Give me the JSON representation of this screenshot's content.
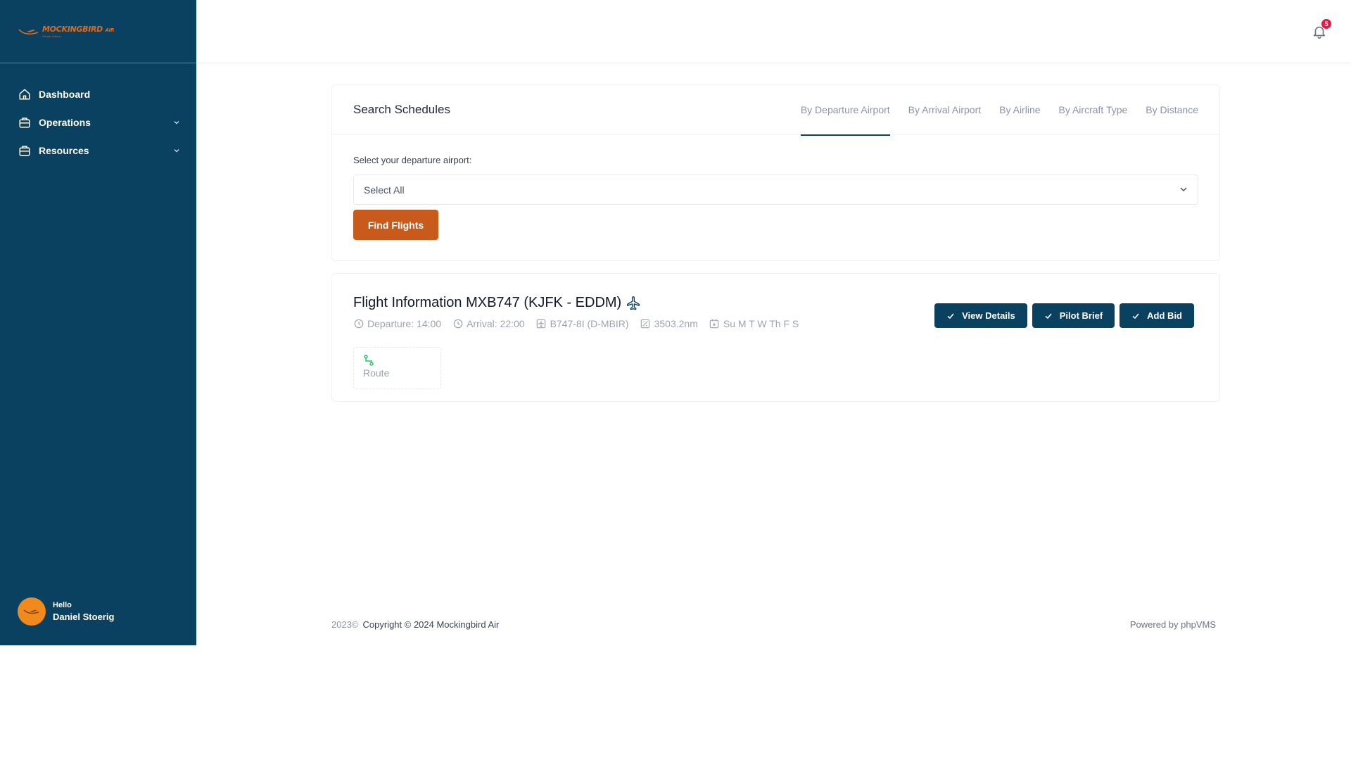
{
  "brand": {
    "logo_text": "MOCKINGBIRD",
    "logo_sub": "AIR",
    "logo_tagline": "Virtual Airline"
  },
  "sidebar": {
    "items": [
      {
        "label": "Dashboard",
        "icon": "home-icon"
      },
      {
        "label": "Operations",
        "icon": "briefcase-icon"
      },
      {
        "label": "Resources",
        "icon": "briefcase-icon"
      }
    ]
  },
  "user": {
    "greeting": "Hello",
    "name": "Daniel Stoerig"
  },
  "notifications": {
    "count": "5"
  },
  "search": {
    "title": "Search Schedules",
    "tabs": [
      "By Departure Airport",
      "By Arrival Airport",
      "By Airline",
      "By Aircraft Type",
      "By Distance"
    ],
    "field_label": "Select your departure airport:",
    "select_value": "Select All",
    "find_button": "Find Flights"
  },
  "flight": {
    "title": "Flight Information MXB747 (KJFK - EDDM)",
    "departure": "Departure: 14:00",
    "arrival": "Arrival: 22:00",
    "aircraft": "B747-8I (D-MBIR)",
    "distance": "3503.2nm",
    "days": "Su M T W Th F S",
    "buttons": {
      "details": "View Details",
      "brief": "Pilot Brief",
      "bid": "Add Bid"
    },
    "route_label": "Route"
  },
  "footer": {
    "year": "2023©",
    "copyright": "Copyright © 2024 Mockingbird Air",
    "powered": "Powered by phpVMS"
  },
  "colors": {
    "sidebar": "#0b4160",
    "accent": "#c85a1c",
    "primary_button": "#0b4160",
    "badge": "#e11d48"
  }
}
